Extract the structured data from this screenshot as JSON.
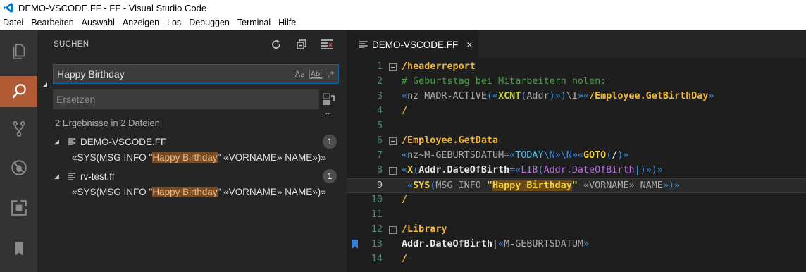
{
  "window": {
    "title": "DEMO-VSCODE.FF - FF - Visual Studio Code"
  },
  "menu": [
    "Datei",
    "Bearbeiten",
    "Auswahl",
    "Anzeigen",
    "Los",
    "Debuggen",
    "Terminal",
    "Hilfe"
  ],
  "activity": [
    "explorer-icon",
    "search-icon",
    "source-control-icon",
    "debug-icon",
    "extensions-icon",
    "bookmarks-icon"
  ],
  "sidebar": {
    "title": "SUCHEN",
    "search": {
      "value": "Happy Birthday",
      "opt_case": "Aa",
      "opt_word": "Abl",
      "opt_regex": ".*"
    },
    "replace": {
      "placeholder": "Ersetzen"
    },
    "more": "...",
    "summary": "2 Ergebnisse in 2 Dateien",
    "results": [
      {
        "file": "DEMO-VSCODE.FF",
        "count": "1",
        "pre": "«SYS(MSG INFO \"",
        "match": "Happy Birthday",
        "post": "\" «VORNAME» NAME»)»"
      },
      {
        "file": "rv-test.ff",
        "count": "1",
        "pre": "«SYS(MSG INFO \"",
        "match": "Happy Birthday",
        "post": "\" «VORNAME» NAME»)»"
      }
    ]
  },
  "editor": {
    "tab": {
      "label": "DEMO-VSCODE.FF",
      "close": "×"
    },
    "lines": [
      {
        "n": "1",
        "fold": true,
        "segs": [
          [
            "c-orange",
            "/headerreport"
          ]
        ]
      },
      {
        "n": "2",
        "segs": [
          [
            "c-green",
            "# Geburtstag bei Mitarbeitern holen:"
          ]
        ]
      },
      {
        "n": "3",
        "segs": [
          [
            "c-blue",
            "«"
          ],
          [
            "c-gray",
            "nz "
          ],
          [
            "c-gray",
            "MADR-ACTIVE"
          ],
          [
            "c-blue",
            "(«"
          ],
          [
            "c-lime",
            "XCNT"
          ],
          [
            "c-blue",
            "("
          ],
          [
            "c-gray",
            "Addr"
          ],
          [
            "c-blue",
            ")»)"
          ],
          [
            "c-gray",
            "\\I"
          ],
          [
            "c-blue",
            "»«"
          ],
          [
            "c-orange",
            "/Employee.GetBirthDay"
          ],
          [
            "c-blue",
            "»"
          ]
        ]
      },
      {
        "n": "4",
        "segs": [
          [
            "c-orange",
            "/"
          ]
        ]
      },
      {
        "n": "5",
        "segs": []
      },
      {
        "n": "6",
        "fold": true,
        "segs": [
          [
            "c-orange",
            "/Employee.GetData"
          ]
        ]
      },
      {
        "n": "7",
        "segs": [
          [
            "c-blue",
            "«"
          ],
          [
            "c-gray",
            "nz~M-GEBURTSDATUM="
          ],
          [
            "c-blue",
            "«"
          ],
          [
            "c-cyan",
            "TODAY"
          ],
          [
            "c-blue",
            "\\N"
          ],
          [
            "c-blue",
            "»"
          ],
          [
            "c-blue",
            "\\N"
          ],
          [
            "c-blue",
            "»«"
          ],
          [
            "c-yellow",
            "GOTO"
          ],
          [
            "c-blue",
            "("
          ],
          [
            "c-white",
            "/"
          ],
          [
            "c-blue",
            ")»"
          ]
        ]
      },
      {
        "n": "8",
        "fold": true,
        "segs": [
          [
            "c-blue",
            "«"
          ],
          [
            "c-yellow",
            "X"
          ],
          [
            "c-blue",
            "("
          ],
          [
            "c-ident",
            "Addr.DateOfBirth"
          ],
          [
            "c-blue",
            "=«"
          ],
          [
            "c-purple",
            "LIB"
          ],
          [
            "c-blue",
            "("
          ],
          [
            "c-purple",
            "Addr.DateOfBirth"
          ],
          [
            "c-blue",
            "|)»)»"
          ]
        ]
      },
      {
        "n": "9",
        "current": true,
        "segs": [
          [
            "c-blue",
            " «"
          ],
          [
            "c-yellow",
            "SYS"
          ],
          [
            "c-blue",
            "("
          ],
          [
            "c-gray",
            "MSG INFO "
          ],
          [
            "c-yellow",
            "\""
          ],
          [
            "c-yellow hl-code",
            "Happy Birthday"
          ],
          [
            "c-yellow",
            "\""
          ],
          [
            "c-gray",
            " «VORNAME» NAME"
          ],
          [
            "c-blue",
            "»)»"
          ]
        ]
      },
      {
        "n": "10",
        "segs": [
          [
            "c-orange",
            "/"
          ]
        ]
      },
      {
        "n": "11",
        "segs": []
      },
      {
        "n": "12",
        "fold": true,
        "segs": [
          [
            "c-orange",
            "/Library"
          ]
        ]
      },
      {
        "n": "13",
        "bookmark": true,
        "segs": [
          [
            "c-ident",
            "Addr.DateOfBirth"
          ],
          [
            "c-gray",
            "|"
          ],
          [
            "c-blue",
            "«"
          ],
          [
            "c-gray",
            "M-GEBURTSDATUM"
          ],
          [
            "c-blue",
            "»"
          ]
        ]
      },
      {
        "n": "14",
        "segs": [
          [
            "c-orange",
            "/"
          ]
        ]
      }
    ]
  }
}
